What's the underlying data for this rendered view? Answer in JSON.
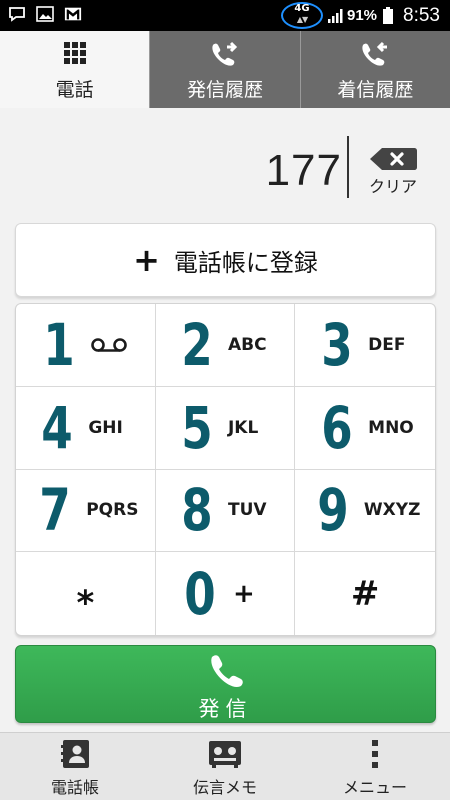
{
  "status_bar": {
    "network_label": "4G",
    "battery_percent": "91%",
    "time": "8:53",
    "icons": [
      "notification-icon",
      "gallery-icon",
      "gmail-icon",
      "signal-icon",
      "battery-icon"
    ]
  },
  "tabs": [
    {
      "label": "電話",
      "icon": "keypad-grid-icon",
      "active": true
    },
    {
      "label": "発信履歴",
      "icon": "outgoing-call-icon",
      "active": false
    },
    {
      "label": "着信履歴",
      "icon": "incoming-call-icon",
      "active": false
    }
  ],
  "display": {
    "number": "177",
    "clear_label": "クリア"
  },
  "add_contact": {
    "plus": "+",
    "label": "電話帳に登録"
  },
  "keypad": {
    "k1": {
      "digit": "1"
    },
    "k2": {
      "digit": "2",
      "letters": "ABC"
    },
    "k3": {
      "digit": "3",
      "letters": "DEF"
    },
    "k4": {
      "digit": "4",
      "letters": "GHI"
    },
    "k5": {
      "digit": "5",
      "letters": "JKL"
    },
    "k6": {
      "digit": "6",
      "letters": "MNO"
    },
    "k7": {
      "digit": "7",
      "letters": "PQRS"
    },
    "k8": {
      "digit": "8",
      "letters": "TUV"
    },
    "k9": {
      "digit": "9",
      "letters": "WXYZ"
    },
    "star": {
      "symbol": "⁎"
    },
    "k0": {
      "digit": "0",
      "letters": "+"
    },
    "hash": {
      "symbol": "#"
    }
  },
  "call_button": {
    "label": "発信"
  },
  "bottom_nav": [
    {
      "label": "電話帳",
      "icon": "contacts-book-icon"
    },
    {
      "label": "伝言メモ",
      "icon": "voice-memo-icon"
    },
    {
      "label": "メニュー",
      "icon": "menu-dots-icon"
    }
  ],
  "colors": {
    "digit": "#0d5b6b",
    "call_green": "#36a94f",
    "tab_inactive": "#6b6b6b",
    "network_ring": "#1e90ff"
  }
}
